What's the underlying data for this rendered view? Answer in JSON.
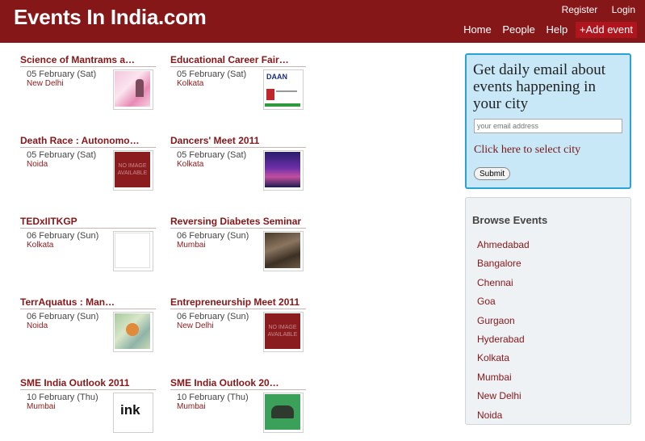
{
  "site": {
    "logo": "Events In India.com"
  },
  "toplinks": {
    "register": "Register",
    "login": "Login"
  },
  "nav": {
    "home": "Home",
    "people": "People",
    "help": "Help",
    "add_event": "+Add event"
  },
  "events": [
    {
      "title": "Science of Mantrams a…",
      "date": "05 February (Sat)",
      "city": "New Delhi",
      "thumb": "pink-flyer"
    },
    {
      "title": "Educational Career Fair…",
      "date": "05 February (Sat)",
      "city": "Kolkata",
      "thumb": "daan-flyer"
    },
    {
      "title": "Death Race : Autonomo…",
      "date": "05 February (Sat)",
      "city": "Noida",
      "thumb": "no-image"
    },
    {
      "title": "Dancers' Meet 2011",
      "date": "05 February (Sat)",
      "city": "Kolkata",
      "thumb": "dancers-poster"
    },
    {
      "title": "TEDxIITKGP",
      "date": "06 February (Sun)",
      "city": "Kolkata",
      "thumb": "empty"
    },
    {
      "title": "Reversing Diabetes Seminar",
      "date": "06 February (Sun)",
      "city": "Mumbai",
      "thumb": "seminar-photo"
    },
    {
      "title": "TerrAquatus : Man…",
      "date": "06 February (Sun)",
      "city": "Noida",
      "thumb": "map-graphic"
    },
    {
      "title": "Entrepreneurship Meet 2011",
      "date": "06 February (Sun)",
      "city": "New Delhi",
      "thumb": "no-image"
    },
    {
      "title": "SME India Outlook 2011",
      "date": "10 February (Thu)",
      "city": "Mumbai",
      "thumb": "ink-logo"
    },
    {
      "title": "SME India Outlook 20…",
      "date": "10 February (Thu)",
      "city": "Mumbai",
      "thumb": "green-logo"
    }
  ],
  "no_image_text": "NO IMAGE AVAILABLE",
  "daan_text": "DAAN",
  "ink_text": "ink",
  "email_box": {
    "heading": "Get daily email about events happening in your city",
    "placeholder": "your email address",
    "city_link": "Click here to select city",
    "submit": "Submit"
  },
  "browse": {
    "heading": "Browse Events",
    "cities": [
      "Ahmedabad",
      "Bangalore",
      "Chennai",
      "Goa",
      "Gurgaon",
      "Hyderabad",
      "Kolkata",
      "Mumbai",
      "New Delhi",
      "Noida"
    ]
  },
  "colors": {
    "brand": "#861719",
    "accent_button": "#b0141c",
    "email_box_bg": "#c8e8f7",
    "email_box_border": "#27a3d5"
  }
}
